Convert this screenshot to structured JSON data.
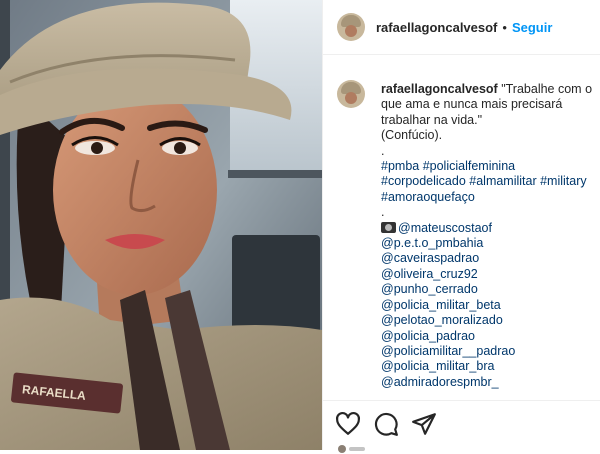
{
  "post": {
    "username": "rafaellagoncalvesof",
    "separator": "•",
    "follow_label": "Seguir",
    "caption": {
      "username": "rafaellagoncalvesof",
      "lines": [
        "\"Trabalhe com o",
        "que ama e nunca mais precisará",
        "trabalhar na vida.\"",
        "(Confúcio).",
        "."
      ],
      "hashtag_lines": [
        "#pmba #policialfeminina",
        "#corpodelicado #almamilitar #military",
        "#amoraoquefaço"
      ],
      "dot_after_tags": ".",
      "camera_icon": "camera-icon",
      "mentions": [
        "@mateuscostaof",
        "@p.e.t.o_pmbahia",
        "@caveiraspadrao",
        "@oliveira_cruz92",
        "@punho_cerrado",
        "@policia_militar_beta",
        "@pelotao_moralizado",
        "@policia_padrao",
        "@policiamilitar__padrao",
        "@policia_militar_bra",
        "@admiradorespmbr_"
      ]
    },
    "photo": {
      "name_tape": "RAFAELLA"
    },
    "colors": {
      "follow": "#0095f6",
      "link": "#00376b",
      "text": "#262626"
    },
    "icons": [
      "heart-icon",
      "comment-icon",
      "share-icon"
    ]
  }
}
